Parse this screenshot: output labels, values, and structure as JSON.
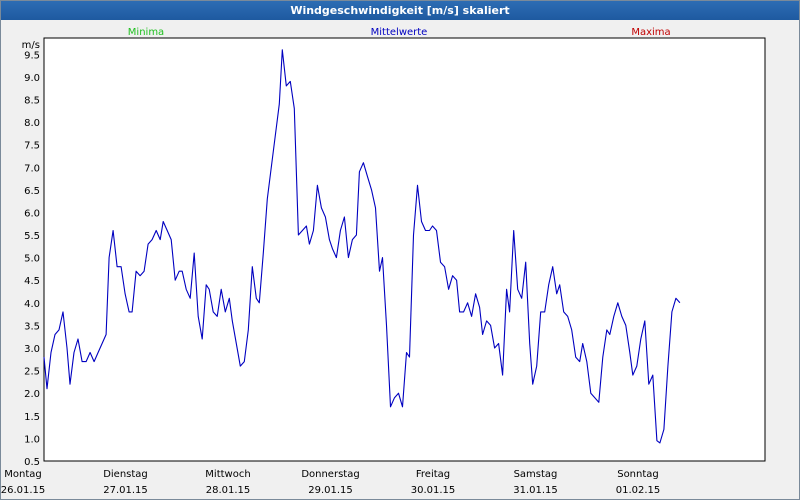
{
  "window": {
    "title": "Windgeschwindigkeit [m/s] skaliert"
  },
  "legend": [
    {
      "name": "Minima",
      "color": "#20c020"
    },
    {
      "name": "Mittelwerte",
      "color": "#0000c0"
    },
    {
      "name": "Maxima",
      "color": "#c00000"
    }
  ],
  "chart_data": {
    "type": "line",
    "ylabel": "m/s",
    "ylim": [
      0.5,
      9.86
    ],
    "y_ticks": [
      "0.5",
      "1.0",
      "1.5",
      "2.0",
      "2.5",
      "3.0",
      "3.5",
      "4.0",
      "4.5",
      "5.0",
      "5.5",
      "6.0",
      "6.5",
      "7.0",
      "7.5",
      "8.0",
      "8.5",
      "9.0",
      "9.5"
    ],
    "xlim": [
      0,
      7.2
    ],
    "x_ticks": [
      {
        "day": "Montag",
        "date": "26.01.15"
      },
      {
        "day": "Dienstag",
        "date": "27.01.15"
      },
      {
        "day": "Mittwoch",
        "date": "28.01.15"
      },
      {
        "day": "Donnerstag",
        "date": "29.01.15"
      },
      {
        "day": "Freitag",
        "date": "30.01.15"
      },
      {
        "day": "Samstag",
        "date": "31.01.15"
      },
      {
        "day": "Sonntag",
        "date": "01.02.15"
      }
    ],
    "grid": true,
    "series": [
      {
        "name": "Mittelwerte",
        "color": "#0000c0",
        "points": [
          [
            0.0,
            2.8
          ],
          [
            0.03,
            2.1
          ],
          [
            0.07,
            2.9
          ],
          [
            0.11,
            3.3
          ],
          [
            0.15,
            3.4
          ],
          [
            0.19,
            3.8
          ],
          [
            0.23,
            3.0
          ],
          [
            0.26,
            2.2
          ],
          [
            0.3,
            2.9
          ],
          [
            0.34,
            3.2
          ],
          [
            0.38,
            2.7
          ],
          [
            0.42,
            2.7
          ],
          [
            0.46,
            2.9
          ],
          [
            0.5,
            2.7
          ],
          [
            0.54,
            2.9
          ],
          [
            0.58,
            3.1
          ],
          [
            0.62,
            3.3
          ],
          [
            0.65,
            5.0
          ],
          [
            0.69,
            5.6
          ],
          [
            0.73,
            4.8
          ],
          [
            0.77,
            4.8
          ],
          [
            0.81,
            4.2
          ],
          [
            0.85,
            3.8
          ],
          [
            0.88,
            3.8
          ],
          [
            0.92,
            4.7
          ],
          [
            0.96,
            4.6
          ],
          [
            1.0,
            4.7
          ],
          [
            1.04,
            5.3
          ],
          [
            1.08,
            5.4
          ],
          [
            1.12,
            5.6
          ],
          [
            1.16,
            5.4
          ],
          [
            1.19,
            5.8
          ],
          [
            1.23,
            5.6
          ],
          [
            1.27,
            5.4
          ],
          [
            1.31,
            4.5
          ],
          [
            1.35,
            4.7
          ],
          [
            1.38,
            4.7
          ],
          [
            1.42,
            4.3
          ],
          [
            1.46,
            4.1
          ],
          [
            1.5,
            5.1
          ],
          [
            1.54,
            3.7
          ],
          [
            1.58,
            3.2
          ],
          [
            1.62,
            4.4
          ],
          [
            1.65,
            4.3
          ],
          [
            1.69,
            3.8
          ],
          [
            1.73,
            3.7
          ],
          [
            1.77,
            4.3
          ],
          [
            1.81,
            3.8
          ],
          [
            1.85,
            4.1
          ],
          [
            1.88,
            3.6
          ],
          [
            1.92,
            3.1
          ],
          [
            1.96,
            2.6
          ],
          [
            2.0,
            2.7
          ],
          [
            2.04,
            3.4
          ],
          [
            2.08,
            4.8
          ],
          [
            2.12,
            4.1
          ],
          [
            2.15,
            4.0
          ],
          [
            2.19,
            5.1
          ],
          [
            2.23,
            6.3
          ],
          [
            2.27,
            7.0
          ],
          [
            2.31,
            7.7
          ],
          [
            2.35,
            8.4
          ],
          [
            2.38,
            9.6
          ],
          [
            2.42,
            8.8
          ],
          [
            2.46,
            8.9
          ],
          [
            2.5,
            8.3
          ],
          [
            2.54,
            5.5
          ],
          [
            2.58,
            5.6
          ],
          [
            2.62,
            5.7
          ],
          [
            2.65,
            5.3
          ],
          [
            2.69,
            5.6
          ],
          [
            2.73,
            6.6
          ],
          [
            2.77,
            6.1
          ],
          [
            2.81,
            5.9
          ],
          [
            2.85,
            5.4
          ],
          [
            2.88,
            5.2
          ],
          [
            2.92,
            5.0
          ],
          [
            2.96,
            5.6
          ],
          [
            3.0,
            5.9
          ],
          [
            3.04,
            5.0
          ],
          [
            3.08,
            5.4
          ],
          [
            3.12,
            5.5
          ],
          [
            3.15,
            6.9
          ],
          [
            3.19,
            7.1
          ],
          [
            3.23,
            6.8
          ],
          [
            3.27,
            6.5
          ],
          [
            3.31,
            6.1
          ],
          [
            3.35,
            4.7
          ],
          [
            3.38,
            5.0
          ],
          [
            3.42,
            3.5
          ],
          [
            3.46,
            1.7
          ],
          [
            3.5,
            1.9
          ],
          [
            3.54,
            2.0
          ],
          [
            3.58,
            1.7
          ],
          [
            3.62,
            2.9
          ],
          [
            3.65,
            2.8
          ],
          [
            3.69,
            5.5
          ],
          [
            3.73,
            6.6
          ],
          [
            3.77,
            5.8
          ],
          [
            3.81,
            5.6
          ],
          [
            3.85,
            5.6
          ],
          [
            3.88,
            5.7
          ],
          [
            3.92,
            5.6
          ],
          [
            3.96,
            4.9
          ],
          [
            4.0,
            4.8
          ],
          [
            4.04,
            4.3
          ],
          [
            4.08,
            4.6
          ],
          [
            4.12,
            4.5
          ],
          [
            4.15,
            3.8
          ],
          [
            4.19,
            3.8
          ],
          [
            4.23,
            4.0
          ],
          [
            4.27,
            3.7
          ],
          [
            4.31,
            4.2
          ],
          [
            4.35,
            3.9
          ],
          [
            4.38,
            3.3
          ],
          [
            4.42,
            3.6
          ],
          [
            4.46,
            3.5
          ],
          [
            4.5,
            3.0
          ],
          [
            4.54,
            3.1
          ],
          [
            4.58,
            2.4
          ],
          [
            4.62,
            4.3
          ],
          [
            4.65,
            3.8
          ],
          [
            4.69,
            5.6
          ],
          [
            4.73,
            4.3
          ],
          [
            4.77,
            4.1
          ],
          [
            4.81,
            4.9
          ],
          [
            4.85,
            3.1
          ],
          [
            4.88,
            2.2
          ],
          [
            4.92,
            2.6
          ],
          [
            4.96,
            3.8
          ],
          [
            5.0,
            3.8
          ],
          [
            5.04,
            4.4
          ],
          [
            5.08,
            4.8
          ],
          [
            5.12,
            4.2
          ],
          [
            5.15,
            4.4
          ],
          [
            5.19,
            3.8
          ],
          [
            5.23,
            3.7
          ],
          [
            5.27,
            3.4
          ],
          [
            5.31,
            2.8
          ],
          [
            5.35,
            2.7
          ],
          [
            5.38,
            3.1
          ],
          [
            5.42,
            2.7
          ],
          [
            5.46,
            2.0
          ],
          [
            5.5,
            1.9
          ],
          [
            5.54,
            1.8
          ],
          [
            5.58,
            2.8
          ],
          [
            5.62,
            3.4
          ],
          [
            5.65,
            3.3
          ],
          [
            5.69,
            3.7
          ],
          [
            5.73,
            4.0
          ],
          [
            5.77,
            3.7
          ],
          [
            5.81,
            3.5
          ],
          [
            5.85,
            2.9
          ],
          [
            5.88,
            2.4
          ],
          [
            5.92,
            2.6
          ],
          [
            5.96,
            3.2
          ],
          [
            6.0,
            3.6
          ],
          [
            6.04,
            2.2
          ],
          [
            6.08,
            2.4
          ],
          [
            6.12,
            0.95
          ],
          [
            6.15,
            0.9
          ],
          [
            6.19,
            1.2
          ],
          [
            6.23,
            2.6
          ],
          [
            6.27,
            3.8
          ],
          [
            6.31,
            4.1
          ],
          [
            6.35,
            4.0
          ]
        ]
      }
    ]
  }
}
